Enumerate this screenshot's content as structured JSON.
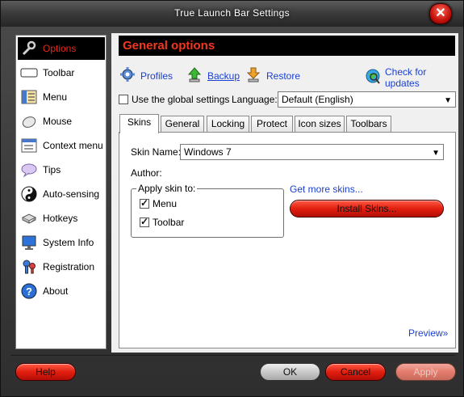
{
  "window": {
    "title": "True Launch Bar Settings",
    "close_glyph": "✕"
  },
  "sidebar": {
    "items": [
      {
        "label": "Options",
        "icon": "wrench-icon",
        "active": true
      },
      {
        "label": "Toolbar",
        "icon": "toolbar-icon"
      },
      {
        "label": "Menu",
        "icon": "menu-icon"
      },
      {
        "label": "Mouse",
        "icon": "mouse-icon"
      },
      {
        "label": "Context menu",
        "icon": "context-menu-icon"
      },
      {
        "label": "Tips",
        "icon": "tips-icon"
      },
      {
        "label": "Auto-sensing",
        "icon": "yin-yang-icon"
      },
      {
        "label": "Hotkeys",
        "icon": "keyboard-icon"
      },
      {
        "label": "System Info",
        "icon": "monitor-icon"
      },
      {
        "label": "Registration",
        "icon": "key-icon"
      },
      {
        "label": "About",
        "icon": "help-icon"
      }
    ]
  },
  "header": {
    "title": "General options"
  },
  "links": {
    "profiles": "Profiles",
    "backup": "Backup",
    "restore": "Restore",
    "updates": "Check for updates"
  },
  "global": {
    "use_global_label": "Use the global settings",
    "language_label": "Language:",
    "language_value": "Default (English)"
  },
  "tabs": [
    "Skins",
    "General",
    "Locking",
    "Protect",
    "Icon sizes",
    "Toolbars"
  ],
  "skins": {
    "skin_name_label": "Skin Name:",
    "skin_name_value": "Windows 7",
    "author_label": "Author:",
    "apply_label": "Apply skin to:",
    "apply_menu": "Menu",
    "apply_toolbar": "Toolbar",
    "get_more": "Get more skins...",
    "install": "Install Skins...",
    "preview": "Preview»"
  },
  "buttons": {
    "help": "Help",
    "ok": "OK",
    "cancel": "Cancel",
    "apply": "Apply"
  },
  "colors": {
    "accent_red": "#e8261b",
    "link_blue": "#1a3fd1",
    "dark_frame": "#2e2e2e"
  }
}
